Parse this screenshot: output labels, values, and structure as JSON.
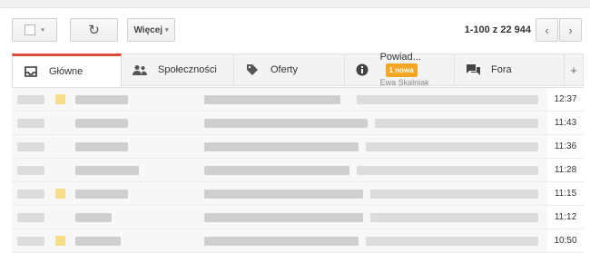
{
  "toolbar": {
    "refresh_glyph": "↻",
    "more_label": "Więcej",
    "caret": "▾",
    "count": "1-100 z 22 944",
    "prev_glyph": "‹",
    "next_glyph": "›"
  },
  "tabs": [
    {
      "label": "Główne",
      "icon": "inbox-icon",
      "active": true
    },
    {
      "label": "Społeczności",
      "icon": "people-icon"
    },
    {
      "label": "Oferty",
      "icon": "tag-icon"
    },
    {
      "label": "Powiad...",
      "badge": "1 nowa",
      "sub": "Ewa Skalniak",
      "icon": "info-icon"
    },
    {
      "label": "Fora",
      "icon": "forum-icon"
    }
  ],
  "add_tab_glyph": "+",
  "emails": [
    {
      "time": "12:37",
      "starred": true
    },
    {
      "time": "11:43",
      "starred": false
    },
    {
      "time": "11:36",
      "starred": false
    },
    {
      "time": "11:28",
      "starred": false
    },
    {
      "time": "11:15",
      "starred": true
    },
    {
      "time": "11:12",
      "starred": false
    },
    {
      "time": "10:50",
      "starred": true
    }
  ],
  "colors": {
    "active_tab_accent": "#dd4b39",
    "badge": "#f5a623"
  }
}
